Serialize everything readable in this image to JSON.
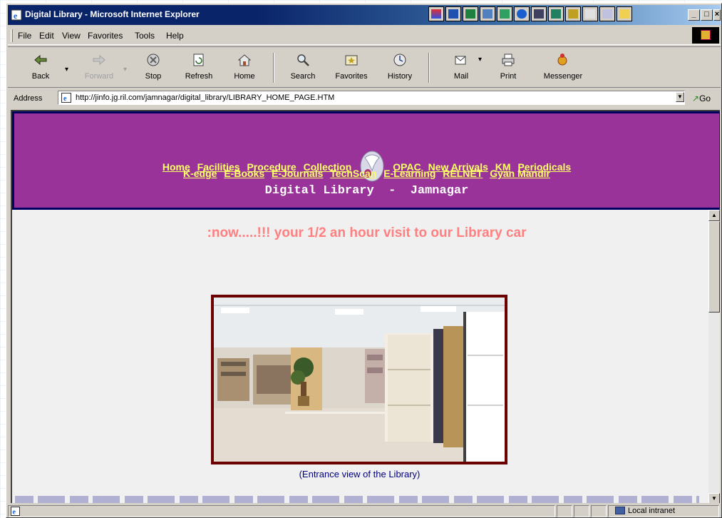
{
  "window": {
    "title": "Digital Library - Microsoft Internet Explorer",
    "minimize": "_",
    "maximize": "□",
    "close": "×"
  },
  "menu": [
    {
      "key": "F",
      "rest": "ile"
    },
    {
      "key": "E",
      "rest": "dit"
    },
    {
      "key": "V",
      "rest": "iew"
    },
    {
      "key": "Fa",
      "rest": "vorites",
      "full": "Favorites"
    },
    {
      "key": "T",
      "rest": "ools"
    },
    {
      "key": "H",
      "rest": "elp"
    }
  ],
  "menu_labels": [
    "File",
    "Edit",
    "View",
    "Favorites",
    "Tools",
    "Help"
  ],
  "toolbar": {
    "back": "Back",
    "forward": "Forward",
    "stop": "Stop",
    "refresh": "Refresh",
    "home": "Home",
    "search": "Search",
    "favorites": "Favorites",
    "history": "History",
    "mail": "Mail",
    "print": "Print",
    "messenger": "Messenger"
  },
  "address": {
    "label": "Address",
    "url": "http://jinfo.jg.ril.com/jamnagar/digital_library/LIBRARY_HOME_PAGE.HTM",
    "go": "Go"
  },
  "page": {
    "nav_row1": [
      "Home",
      "Facilities",
      "Procedure",
      "Collection",
      "OPAC",
      "New Arrivals",
      "KM",
      "Periodicals"
    ],
    "nav_row2": [
      "K-edge",
      "E-Books",
      "E-Journals",
      "TechScan",
      "E-Learning",
      "RELNET",
      "Gyan Mandir"
    ],
    "title": "Digital Library  -  Jamnagar",
    "marquee": ":now.....!!! your 1/2 an hour visit to our Library car",
    "caption": "(Entrance view of the Library)"
  },
  "status": {
    "zone": "Local intranet"
  },
  "colors": {
    "banner": "#993399",
    "nav_link": "#ffff66",
    "marquee": "#ff8080",
    "caption": "#000080"
  }
}
